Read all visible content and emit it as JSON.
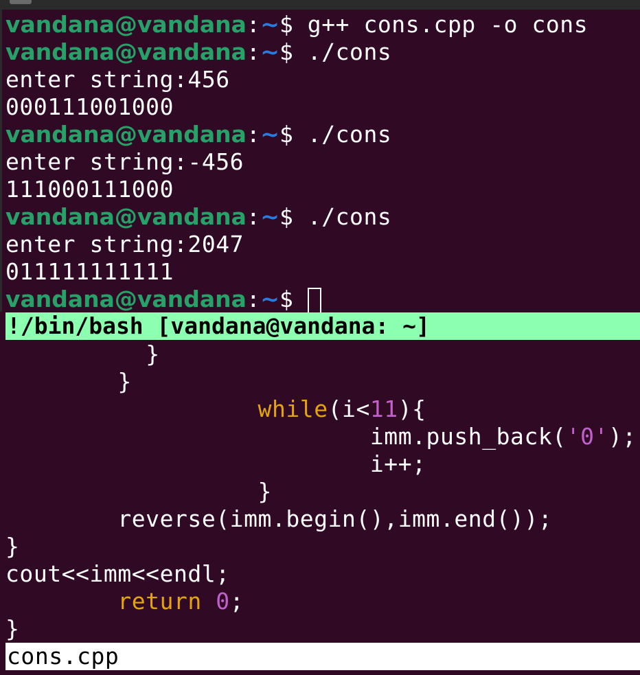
{
  "prompt": {
    "user": "vandana@vandana",
    "colon": ":",
    "path": "~",
    "dollar": "$ "
  },
  "terminal": {
    "cmd1": "g++ cons.cpp -o cons",
    "cmd2": "./cons",
    "out1_prompt": "enter string:456",
    "out1_result": "000111001000",
    "cmd3": "./cons",
    "out2_prompt": "enter string:-456",
    "out2_result": "111000111000",
    "cmd4": "./cons",
    "out3_prompt": "enter string:2047",
    "out3_result": "011111111111"
  },
  "statusbar": {
    "title": "!/bin/bash [vandana@vandana: ~]"
  },
  "editor": {
    "line1": "}",
    "line2": "}",
    "while_kw": "while",
    "while_open": "(i<",
    "while_num": "11",
    "while_close": "){",
    "push_pre": "imm.push_back(",
    "push_char": "'0'",
    "push_post": ");",
    "inc": "i++;",
    "close_brace": "}",
    "reverse": "reverse(imm.begin(),imm.end());",
    "brace_a": "}",
    "cout": "cout<<imm<<endl;",
    "return_kw": "return",
    "return_num": "0",
    "return_semi": ";",
    "brace_b": "}"
  },
  "bottombar": {
    "filename": "cons.cpp"
  },
  "colors": {
    "background": "#300a24",
    "user": "#26a269",
    "path": "#2a7bde",
    "statusbar": "#8dffb0",
    "keyword": "#e5a50a",
    "literal": "#c061cb"
  }
}
